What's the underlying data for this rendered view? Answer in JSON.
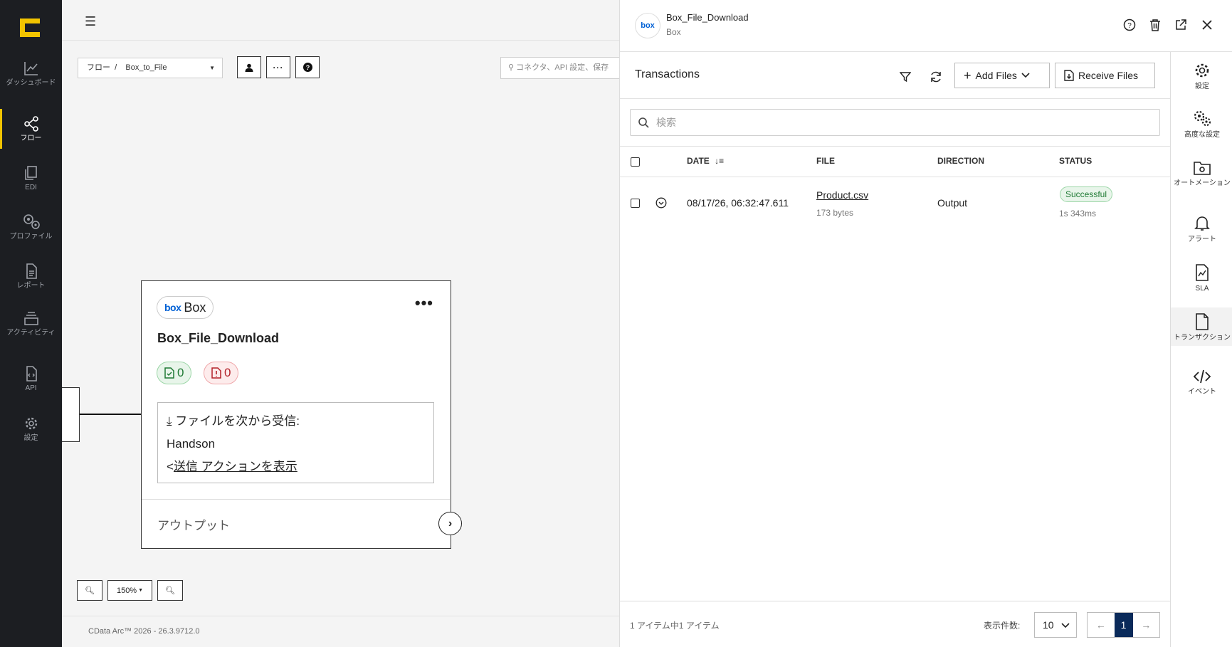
{
  "nav": {
    "items": [
      {
        "label": "ダッシュボード",
        "icon": "dashboard-icon"
      },
      {
        "label": "フロー",
        "icon": "flow-icon"
      },
      {
        "label": "EDI",
        "icon": "edi-icon"
      },
      {
        "label": "プロファイル",
        "icon": "profile-icon"
      },
      {
        "label": "レポート",
        "icon": "report-icon"
      },
      {
        "label": "アクティビティ",
        "icon": "activity-icon"
      },
      {
        "label": "API",
        "icon": "api-icon"
      },
      {
        "label": "設定",
        "icon": "settings-icon"
      }
    ]
  },
  "canvas": {
    "breadcrumb": "フロー  /    Box_to_File",
    "search_placeholder": "コネクタ、API 設定、保存",
    "zoom_level": "150%",
    "version": "CData Arc™ 2026 - 26.3.9712.0"
  },
  "node": {
    "connector_type": "Box",
    "name": "Box_File_Download",
    "success_count": "0",
    "error_count": "0",
    "receive_label": "ファイルを次から受信:",
    "receive_source": "Handson",
    "show_send_action": "送信 アクションを表示",
    "output_label": "アウトプット"
  },
  "panel": {
    "title": "Box_File_Download",
    "subtitle": "Box",
    "avatar_text": "box",
    "section_title": "Transactions",
    "add_files": "Add Files",
    "receive_files": "Receive Files",
    "search_placeholder": "検索",
    "columns": {
      "date": "DATE",
      "file": "FILE",
      "direction": "DIRECTION",
      "status": "STATUS"
    },
    "rows": [
      {
        "date": "08/17/26, 06:32:47.611",
        "file": "Product.csv",
        "size": "173 bytes",
        "direction": "Output",
        "status": "Successful",
        "duration": "1s 343ms"
      }
    ],
    "footer_count": "1 アイテム中1 アイテム",
    "per_page_label": "表示件数:",
    "per_page": "10",
    "current_page": "1"
  },
  "rail": {
    "items": [
      {
        "label": "設定"
      },
      {
        "label": "高度な設定"
      },
      {
        "label": "オートメーション"
      },
      {
        "label": "アラート"
      },
      {
        "label": "SLA"
      },
      {
        "label": "トランザクション"
      },
      {
        "label": "イベント"
      }
    ]
  },
  "colors": {
    "accent": "#f2c400",
    "success": "#1f7a34",
    "error": "#b3222a",
    "box_brand": "#0061d5"
  }
}
